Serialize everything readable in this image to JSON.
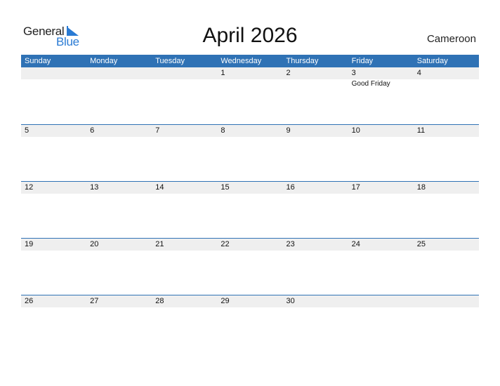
{
  "logo": {
    "general": "General",
    "blue": "Blue"
  },
  "title": "April 2026",
  "country": "Cameroon",
  "weekdays": [
    "Sunday",
    "Monday",
    "Tuesday",
    "Wednesday",
    "Thursday",
    "Friday",
    "Saturday"
  ],
  "weeks": [
    {
      "days": [
        "",
        "",
        "",
        "1",
        "2",
        "3",
        "4"
      ],
      "events": [
        "",
        "",
        "",
        "",
        "",
        "Good Friday",
        ""
      ]
    },
    {
      "days": [
        "5",
        "6",
        "7",
        "8",
        "9",
        "10",
        "11"
      ],
      "events": [
        "",
        "",
        "",
        "",
        "",
        "",
        ""
      ]
    },
    {
      "days": [
        "12",
        "13",
        "14",
        "15",
        "16",
        "17",
        "18"
      ],
      "events": [
        "",
        "",
        "",
        "",
        "",
        "",
        ""
      ]
    },
    {
      "days": [
        "19",
        "20",
        "21",
        "22",
        "23",
        "24",
        "25"
      ],
      "events": [
        "",
        "",
        "",
        "",
        "",
        "",
        ""
      ]
    },
    {
      "days": [
        "26",
        "27",
        "28",
        "29",
        "30",
        "",
        ""
      ],
      "events": [
        "",
        "",
        "",
        "",
        "",
        "",
        ""
      ]
    }
  ],
  "colors": {
    "header": "#2f72b5",
    "strip": "#efefef",
    "brand_blue": "#2a7bd4"
  }
}
